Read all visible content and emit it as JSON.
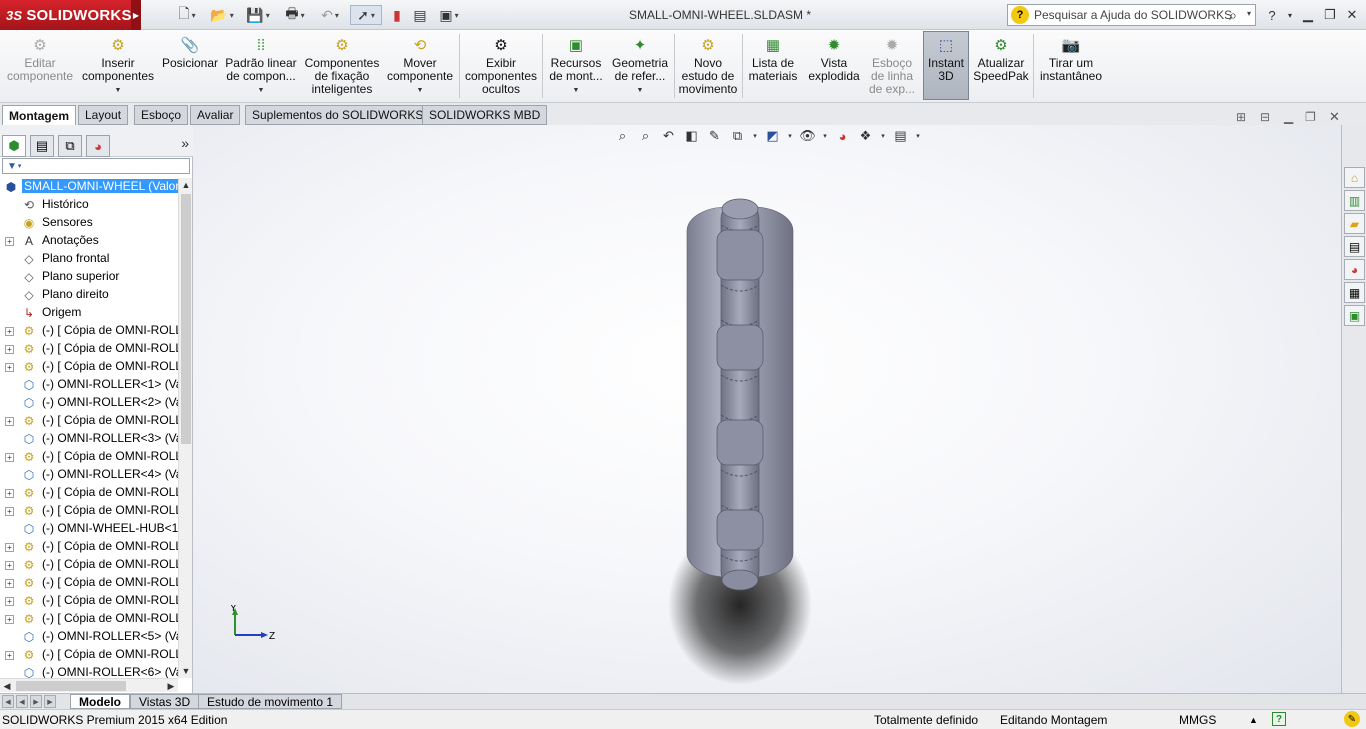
{
  "app": {
    "brand": "SOLIDWORKS",
    "brand_prefix": "3S",
    "document_title": "SMALL-OMNI-WHEEL.SLDASM *"
  },
  "search": {
    "placeholder": "Pesquisar a Ajuda do SOLIDWORKS"
  },
  "command_manager": {
    "items": [
      {
        "label": "Editar componente",
        "icon": "edit-component-icon",
        "disabled": true
      },
      {
        "label": "Inserir componentes",
        "icon": "insert-components-icon"
      },
      {
        "label": "Posicionar",
        "icon": "mate-icon"
      },
      {
        "label": "Padrão linear de compon...",
        "icon": "linear-pattern-icon"
      },
      {
        "label": "Componentes de fixação inteligentes",
        "icon": "smart-fasteners-icon"
      },
      {
        "label": "Mover componente",
        "icon": "move-component-icon"
      },
      {
        "label": "Exibir componentes ocultos",
        "icon": "show-hidden-icon"
      },
      {
        "label": "Recursos de mont...",
        "icon": "assembly-features-icon"
      },
      {
        "label": "Geometria de refer...",
        "icon": "reference-geometry-icon"
      },
      {
        "label": "Novo estudo de movimento",
        "icon": "motion-study-icon"
      },
      {
        "label": "Lista de materiais",
        "icon": "bom-icon"
      },
      {
        "label": "Vista explodida",
        "icon": "exploded-view-icon"
      },
      {
        "label": "Esboço de linha de exp...",
        "icon": "explode-line-sketch-icon",
        "disabled": true
      },
      {
        "label": "Instant 3D",
        "icon": "instant3d-icon",
        "active": true
      },
      {
        "label": "Atualizar SpeedPak",
        "icon": "speedpak-icon"
      },
      {
        "label": "Tirar um instantâneo",
        "icon": "snapshot-icon"
      }
    ]
  },
  "cm_tabs": [
    "Montagem",
    "Layout",
    "Esboço",
    "Avaliar",
    "Suplementos do SOLIDWORKS",
    "SOLIDWORKS MBD"
  ],
  "tree": {
    "root": "SMALL-OMNI-WHEEL  (Valor",
    "items": [
      {
        "label": "Histórico",
        "icon": "history-icon"
      },
      {
        "label": "Sensores",
        "icon": "sensors-icon"
      },
      {
        "label": "Anotações",
        "icon": "annotations-icon",
        "expandable": true
      },
      {
        "label": "Plano frontal",
        "icon": "plane-icon"
      },
      {
        "label": "Plano superior",
        "icon": "plane-icon"
      },
      {
        "label": "Plano direito",
        "icon": "plane-icon"
      },
      {
        "label": "Origem",
        "icon": "origin-icon"
      },
      {
        "label": "(-) [ Cópia de OMNI-ROLL",
        "icon": "subassembly-icon",
        "expandable": true
      },
      {
        "label": "(-) [ Cópia de OMNI-ROLL",
        "icon": "subassembly-icon",
        "expandable": true
      },
      {
        "label": "(-) [ Cópia de OMNI-ROLL",
        "icon": "subassembly-icon",
        "expandable": true
      },
      {
        "label": "(-) OMNI-ROLLER<1> (Va",
        "icon": "part-icon",
        "expandable": false
      },
      {
        "label": "(-) OMNI-ROLLER<2> (Va",
        "icon": "part-icon",
        "expandable": false
      },
      {
        "label": "(-) [ Cópia de OMNI-ROLL",
        "icon": "subassembly-icon",
        "expandable": true
      },
      {
        "label": "(-) OMNI-ROLLER<3> (Va",
        "icon": "part-icon",
        "expandable": false
      },
      {
        "label": "(-) [ Cópia de OMNI-ROLL",
        "icon": "subassembly-icon",
        "expandable": true
      },
      {
        "label": "(-) OMNI-ROLLER<4> (Va",
        "icon": "part-icon",
        "expandable": false
      },
      {
        "label": "(-) [ Cópia de OMNI-ROLL",
        "icon": "subassembly-icon",
        "expandable": true
      },
      {
        "label": "(-) [ Cópia de OMNI-ROLL",
        "icon": "subassembly-icon",
        "expandable": true
      },
      {
        "label": "(-) OMNI-WHEEL-HUB<1",
        "icon": "part-icon",
        "expandable": false
      },
      {
        "label": "(-) [ Cópia de OMNI-ROLL",
        "icon": "subassembly-icon",
        "expandable": true
      },
      {
        "label": "(-) [ Cópia de OMNI-ROLL",
        "icon": "subassembly-icon",
        "expandable": true
      },
      {
        "label": "(-) [ Cópia de OMNI-ROLL",
        "icon": "subassembly-icon",
        "expandable": true
      },
      {
        "label": "(-) [ Cópia de OMNI-ROLL",
        "icon": "subassembly-icon",
        "expandable": true
      },
      {
        "label": "(-) [ Cópia de OMNI-ROLL",
        "icon": "subassembly-icon",
        "expandable": true
      },
      {
        "label": "(-) OMNI-ROLLER<5> (Va",
        "icon": "part-icon",
        "expandable": false
      },
      {
        "label": "(-) [ Cópia de OMNI-ROLL",
        "icon": "subassembly-icon",
        "expandable": true
      },
      {
        "label": "(-) OMNI-ROLLER<6> (Va",
        "icon": "part-icon",
        "expandable": false
      }
    ]
  },
  "triad": {
    "y": "Y",
    "z": "Z"
  },
  "bottom_tabs": [
    "Modelo",
    "Vistas 3D",
    "Estudo de movimento 1"
  ],
  "status": {
    "edition": "SOLIDWORKS Premium 2015 x64 Edition",
    "definition": "Totalmente definido",
    "mode": "Editando Montagem",
    "units": "MMGS"
  },
  "colors": {
    "brand_red": "#c8202a",
    "selection": "#3399ff",
    "model": "#9a9dae"
  }
}
